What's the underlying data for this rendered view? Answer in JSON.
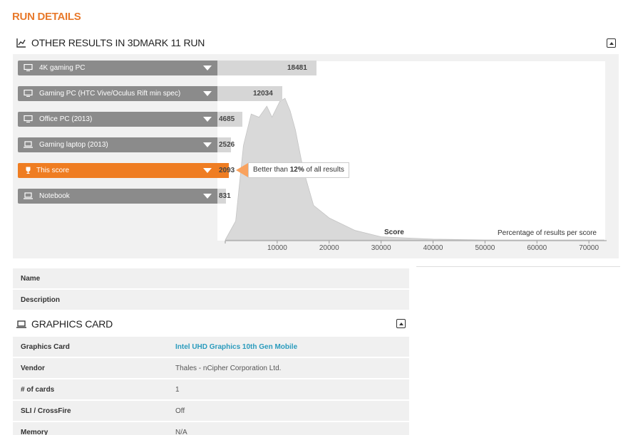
{
  "page": {
    "title": "RUN DETAILS"
  },
  "results_section": {
    "title": "OTHER RESULTS IN 3DMARK 11 RUN",
    "rows": [
      {
        "label": "4K gaming PC",
        "value": "18481",
        "score": 18481,
        "icon": "desktop-icon",
        "active": false
      },
      {
        "label": "Gaming PC (HTC Vive/Oculus Rift min spec)",
        "value": "12034",
        "score": 12034,
        "icon": "desktop-icon",
        "active": false
      },
      {
        "label": "Office PC (2013)",
        "value": "4685",
        "score": 4685,
        "icon": "desktop-icon",
        "active": false
      },
      {
        "label": "Gaming laptop (2013)",
        "value": "2526",
        "score": 2526,
        "icon": "laptop-icon",
        "active": false
      },
      {
        "label": "This score",
        "value": "2093",
        "score": 2093,
        "icon": "trophy-icon",
        "active": true
      },
      {
        "label": "Notebook",
        "value": "831",
        "score": 831,
        "icon": "laptop-icon",
        "active": false
      }
    ],
    "tooltip": {
      "prefix": "Better than ",
      "percent": "12%",
      "suffix": " of all results"
    },
    "axis": {
      "x_title": "Score",
      "y_title": "Percentage of results per score",
      "ticks": [
        "10000",
        "20000",
        "30000",
        "40000",
        "50000",
        "60000",
        "70000"
      ]
    },
    "colors": {
      "accent": "#ef7d22",
      "bar": "#8b8b8b",
      "fill": "#d6d6d6"
    }
  },
  "chart_data": {
    "type": "area",
    "title": "",
    "xlabel": "Score",
    "ylabel": "Percentage of results per score",
    "xlim": [
      0,
      73000
    ],
    "x": [
      0,
      2000,
      3500,
      5000,
      6500,
      8000,
      9000,
      10500,
      11500,
      12500,
      13500,
      15000,
      17000,
      20000,
      25000,
      30000,
      40000,
      50000,
      73000
    ],
    "series": [
      {
        "values": [
          0,
          12,
          60,
          80,
          78,
          85,
          78,
          88,
          90,
          82,
          70,
          45,
          22,
          14,
          6,
          2,
          0.5,
          0,
          0
        ]
      }
    ]
  },
  "info": {
    "rows": [
      {
        "key": "Name",
        "value": ""
      },
      {
        "key": "Description",
        "value": ""
      }
    ]
  },
  "graphics_section": {
    "title": "GRAPHICS CARD",
    "rows": [
      {
        "key": "Graphics Card",
        "value": "Intel UHD Graphics 10th Gen Mobile",
        "link": true
      },
      {
        "key": "Vendor",
        "value": "Thales - nCipher Corporation Ltd.",
        "link": false
      },
      {
        "key": "# of cards",
        "value": "1",
        "link": false
      },
      {
        "key": "SLI / CrossFire",
        "value": "Off",
        "link": false
      },
      {
        "key": "Memory",
        "value": "N/A",
        "link": false
      }
    ]
  }
}
